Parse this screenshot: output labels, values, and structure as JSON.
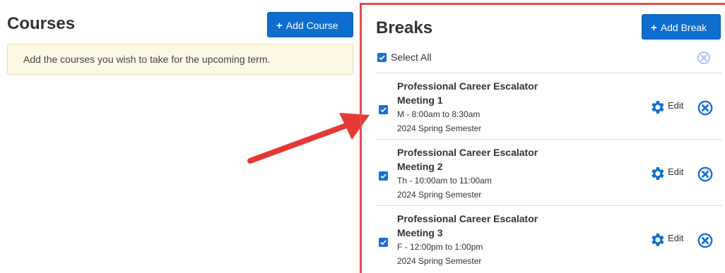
{
  "courses": {
    "title": "Courses",
    "add_label": "Add Course",
    "notice": "Add the courses you wish to take for the upcoming term."
  },
  "breaks": {
    "title": "Breaks",
    "add_label": "Add Break",
    "select_all_label": "Select All",
    "edit_label": "Edit",
    "items": [
      {
        "title_line1": "Professional Career Escalator",
        "title_line2": "Meeting 1",
        "time": "M - 8:00am to 8:30am",
        "term": "2024 Spring Semester",
        "checked": true
      },
      {
        "title_line1": "Professional Career Escalator",
        "title_line2": "Meeting 2",
        "time": "Th - 10:00am to 11:00am",
        "term": "2024 Spring Semester",
        "checked": true
      },
      {
        "title_line1": "Professional Career Escalator",
        "title_line2": "Meeting 3",
        "time": "F - 12:00pm to 1:00pm",
        "term": "2024 Spring Semester",
        "checked": true
      }
    ]
  },
  "colors": {
    "primary": "#0d6ecf",
    "notice_bg": "#fcf8e3",
    "highlight_border": "#e54b4b",
    "remove_icon": "#1a6fd6",
    "clear_all_icon": "#a9c6f0"
  },
  "icons": {
    "add": "plus-icon",
    "edit": "gear-icon",
    "remove": "circle-x-icon",
    "checkbox": "check-icon",
    "annotation": "arrow-icon"
  }
}
